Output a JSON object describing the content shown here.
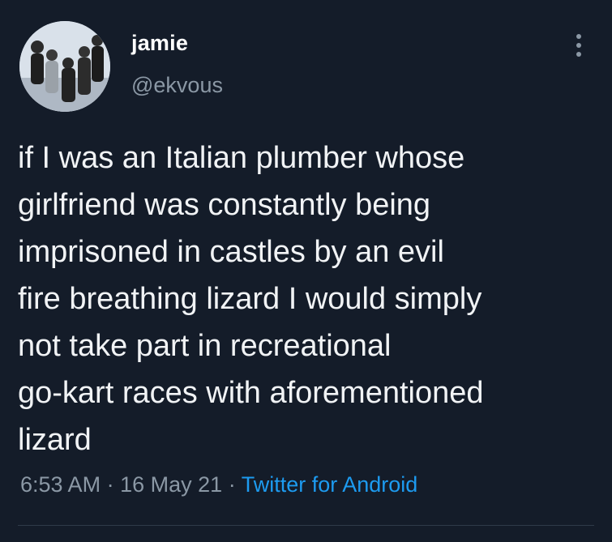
{
  "user": {
    "display_name": "jamie",
    "handle": "@ekvous"
  },
  "tweet": {
    "text": "if I was an Italian plumber whose\ngirlfriend was constantly being\nimprisoned in castles by an evil\nfire breathing lizard I would simply\nnot take part in recreational\ngo-kart races with aforementioned\nlizard"
  },
  "meta": {
    "time": "6:53 AM",
    "separator": "·",
    "date": "16 May 21",
    "source": "Twitter for Android"
  },
  "colors": {
    "background": "#141c29",
    "text": "#f1f3f5",
    "secondary": "#8b98a5",
    "link": "#1d9bf0"
  },
  "icons": {
    "more": "more-options-icon"
  }
}
